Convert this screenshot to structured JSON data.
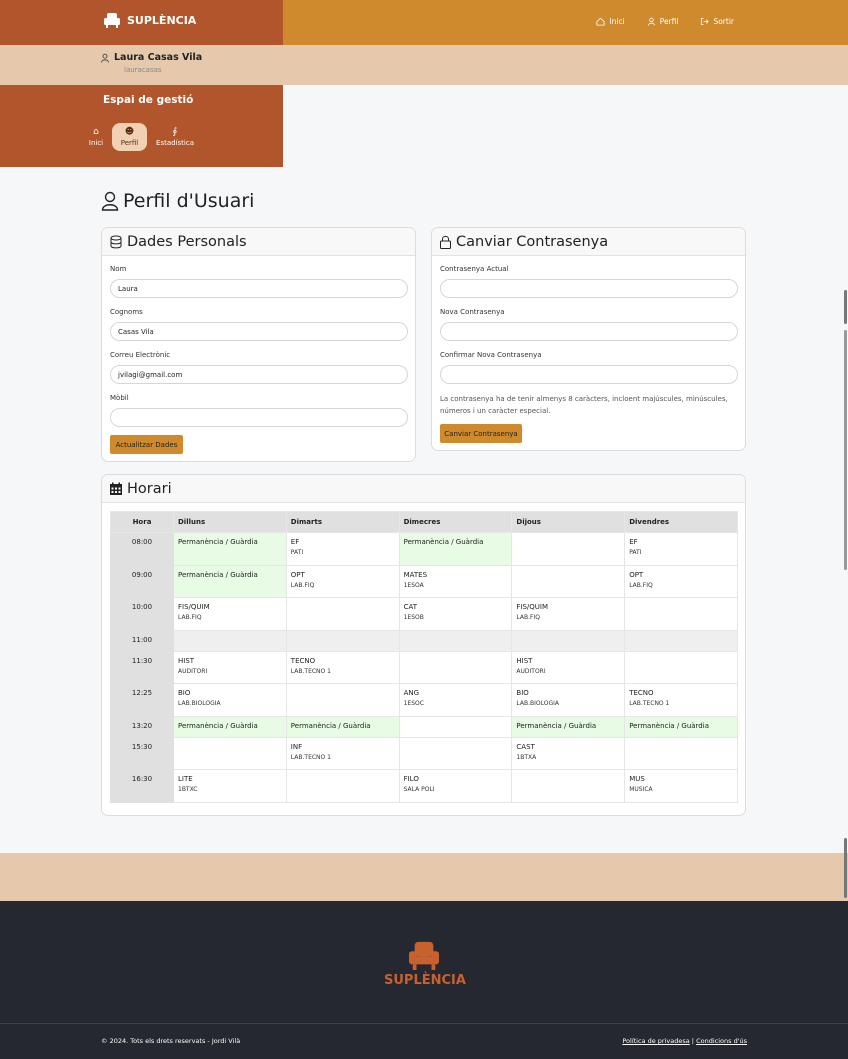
{
  "brand": {
    "name": "SUPLÈNCIA"
  },
  "topnav": {
    "home": "Inici",
    "profile": "Perfil",
    "logout": "Sortir"
  },
  "user": {
    "name": "Laura Casas Vila",
    "login": "lauracasas"
  },
  "sidebar": {
    "title": "Espai de gestió",
    "items": [
      {
        "label": "Inici"
      },
      {
        "label": "Perfil"
      },
      {
        "label": "Estadística"
      }
    ]
  },
  "page": {
    "title": "Perfil d'Usuari"
  },
  "personal": {
    "title": "Dades Personals",
    "nom_label": "Nom",
    "nom_value": "Laura",
    "cognoms_label": "Cognoms",
    "cognoms_value": "Casas Vila",
    "email_label": "Correu Electrònic",
    "email_value": "jvilagi@gmail.com",
    "mobil_label": "Mòbil",
    "mobil_value": "",
    "button": "Actualitzar Dades"
  },
  "password": {
    "title": "Canviar Contrasenya",
    "current_label": "Contrasenya Actual",
    "new_label": "Nova Contrasenya",
    "confirm_label": "Confirmar Nova Contrasenya",
    "note": "La contrasenya ha de tenir almenys 8 caràcters, incloent majúscules, minúscules, números i un caràcter especial.",
    "button": "Canviar Contrasenya"
  },
  "schedule": {
    "title": "Horari",
    "headers": [
      "Hora",
      "Dilluns",
      "Dimarts",
      "Dimecres",
      "Dijous",
      "Divendres"
    ],
    "rows": [
      {
        "hour": "08:00",
        "cells": [
          {
            "s": "Permanència / Guàrdia",
            "r": ""
          },
          {
            "s": "EF",
            "r": "PATI"
          },
          {
            "s": "Permanència / Guàrdia",
            "r": ""
          },
          {
            "s": "",
            "r": ""
          },
          {
            "s": "EF",
            "r": "PATI"
          }
        ]
      },
      {
        "hour": "09:00",
        "cells": [
          {
            "s": "Permanència / Guàrdia",
            "r": ""
          },
          {
            "s": "OPT",
            "r": "LAB.FIQ"
          },
          {
            "s": "MATES",
            "r": "1ESOA"
          },
          {
            "s": "",
            "r": ""
          },
          {
            "s": "OPT",
            "r": "LAB.FIQ"
          }
        ]
      },
      {
        "hour": "10:00",
        "cells": [
          {
            "s": "FIS/QUIM",
            "r": "LAB.FIQ"
          },
          {
            "s": "",
            "r": ""
          },
          {
            "s": "CAT",
            "r": "1ESOB"
          },
          {
            "s": "FIS/QUIM",
            "r": "LAB.FIQ"
          },
          {
            "s": "",
            "r": ""
          }
        ]
      },
      {
        "hour": "11:00",
        "cells": [
          {
            "s": "",
            "r": ""
          },
          {
            "s": "",
            "r": ""
          },
          {
            "s": "",
            "r": ""
          },
          {
            "s": "",
            "r": ""
          },
          {
            "s": "",
            "r": ""
          }
        ]
      },
      {
        "hour": "11:30",
        "cells": [
          {
            "s": "HIST",
            "r": "AUDITORI"
          },
          {
            "s": "TECNO",
            "r": "LAB.TECNO 1"
          },
          {
            "s": "",
            "r": ""
          },
          {
            "s": "HIST",
            "r": "AUDITORI"
          },
          {
            "s": "",
            "r": ""
          }
        ]
      },
      {
        "hour": "12:25",
        "cells": [
          {
            "s": "BIO",
            "r": "LAB.BIOLOGIA"
          },
          {
            "s": "",
            "r": ""
          },
          {
            "s": "ANG",
            "r": "1ESOC"
          },
          {
            "s": "BIO",
            "r": "LAB.BIOLOGIA"
          },
          {
            "s": "TECNO",
            "r": "LAB.TECNO 1"
          }
        ]
      },
      {
        "hour": "13:20",
        "cells": [
          {
            "s": "Permanència / Guàrdia",
            "r": ""
          },
          {
            "s": "Permanència / Guàrdia",
            "r": ""
          },
          {
            "s": "",
            "r": ""
          },
          {
            "s": "Permanència / Guàrdia",
            "r": ""
          },
          {
            "s": "Permanència / Guàrdia",
            "r": ""
          }
        ]
      },
      {
        "hour": "15:30",
        "cells": [
          {
            "s": "",
            "r": ""
          },
          {
            "s": "INF",
            "r": "LAB.TECNO 1"
          },
          {
            "s": "",
            "r": ""
          },
          {
            "s": "CAST",
            "r": "1BTXA"
          },
          {
            "s": "",
            "r": ""
          }
        ]
      },
      {
        "hour": "16:30",
        "cells": [
          {
            "s": "LITE",
            "r": "1BTXC"
          },
          {
            "s": "",
            "r": ""
          },
          {
            "s": "FILO",
            "r": "SALA POLI"
          },
          {
            "s": "",
            "r": ""
          },
          {
            "s": "MUS",
            "r": "MUSICA"
          }
        ]
      }
    ]
  },
  "footer": {
    "copyright": "© 2024. Tots els drets reservats - Jordi Vilà",
    "privacy": "Política de privadesa",
    "separator": "|",
    "terms": "Condicions d'ús"
  },
  "colors": {
    "accent": "#cf8a2d",
    "brand": "#b1562c",
    "band": "#e6c8ac",
    "footer": "#252830",
    "guard": "#e7fbe5"
  }
}
